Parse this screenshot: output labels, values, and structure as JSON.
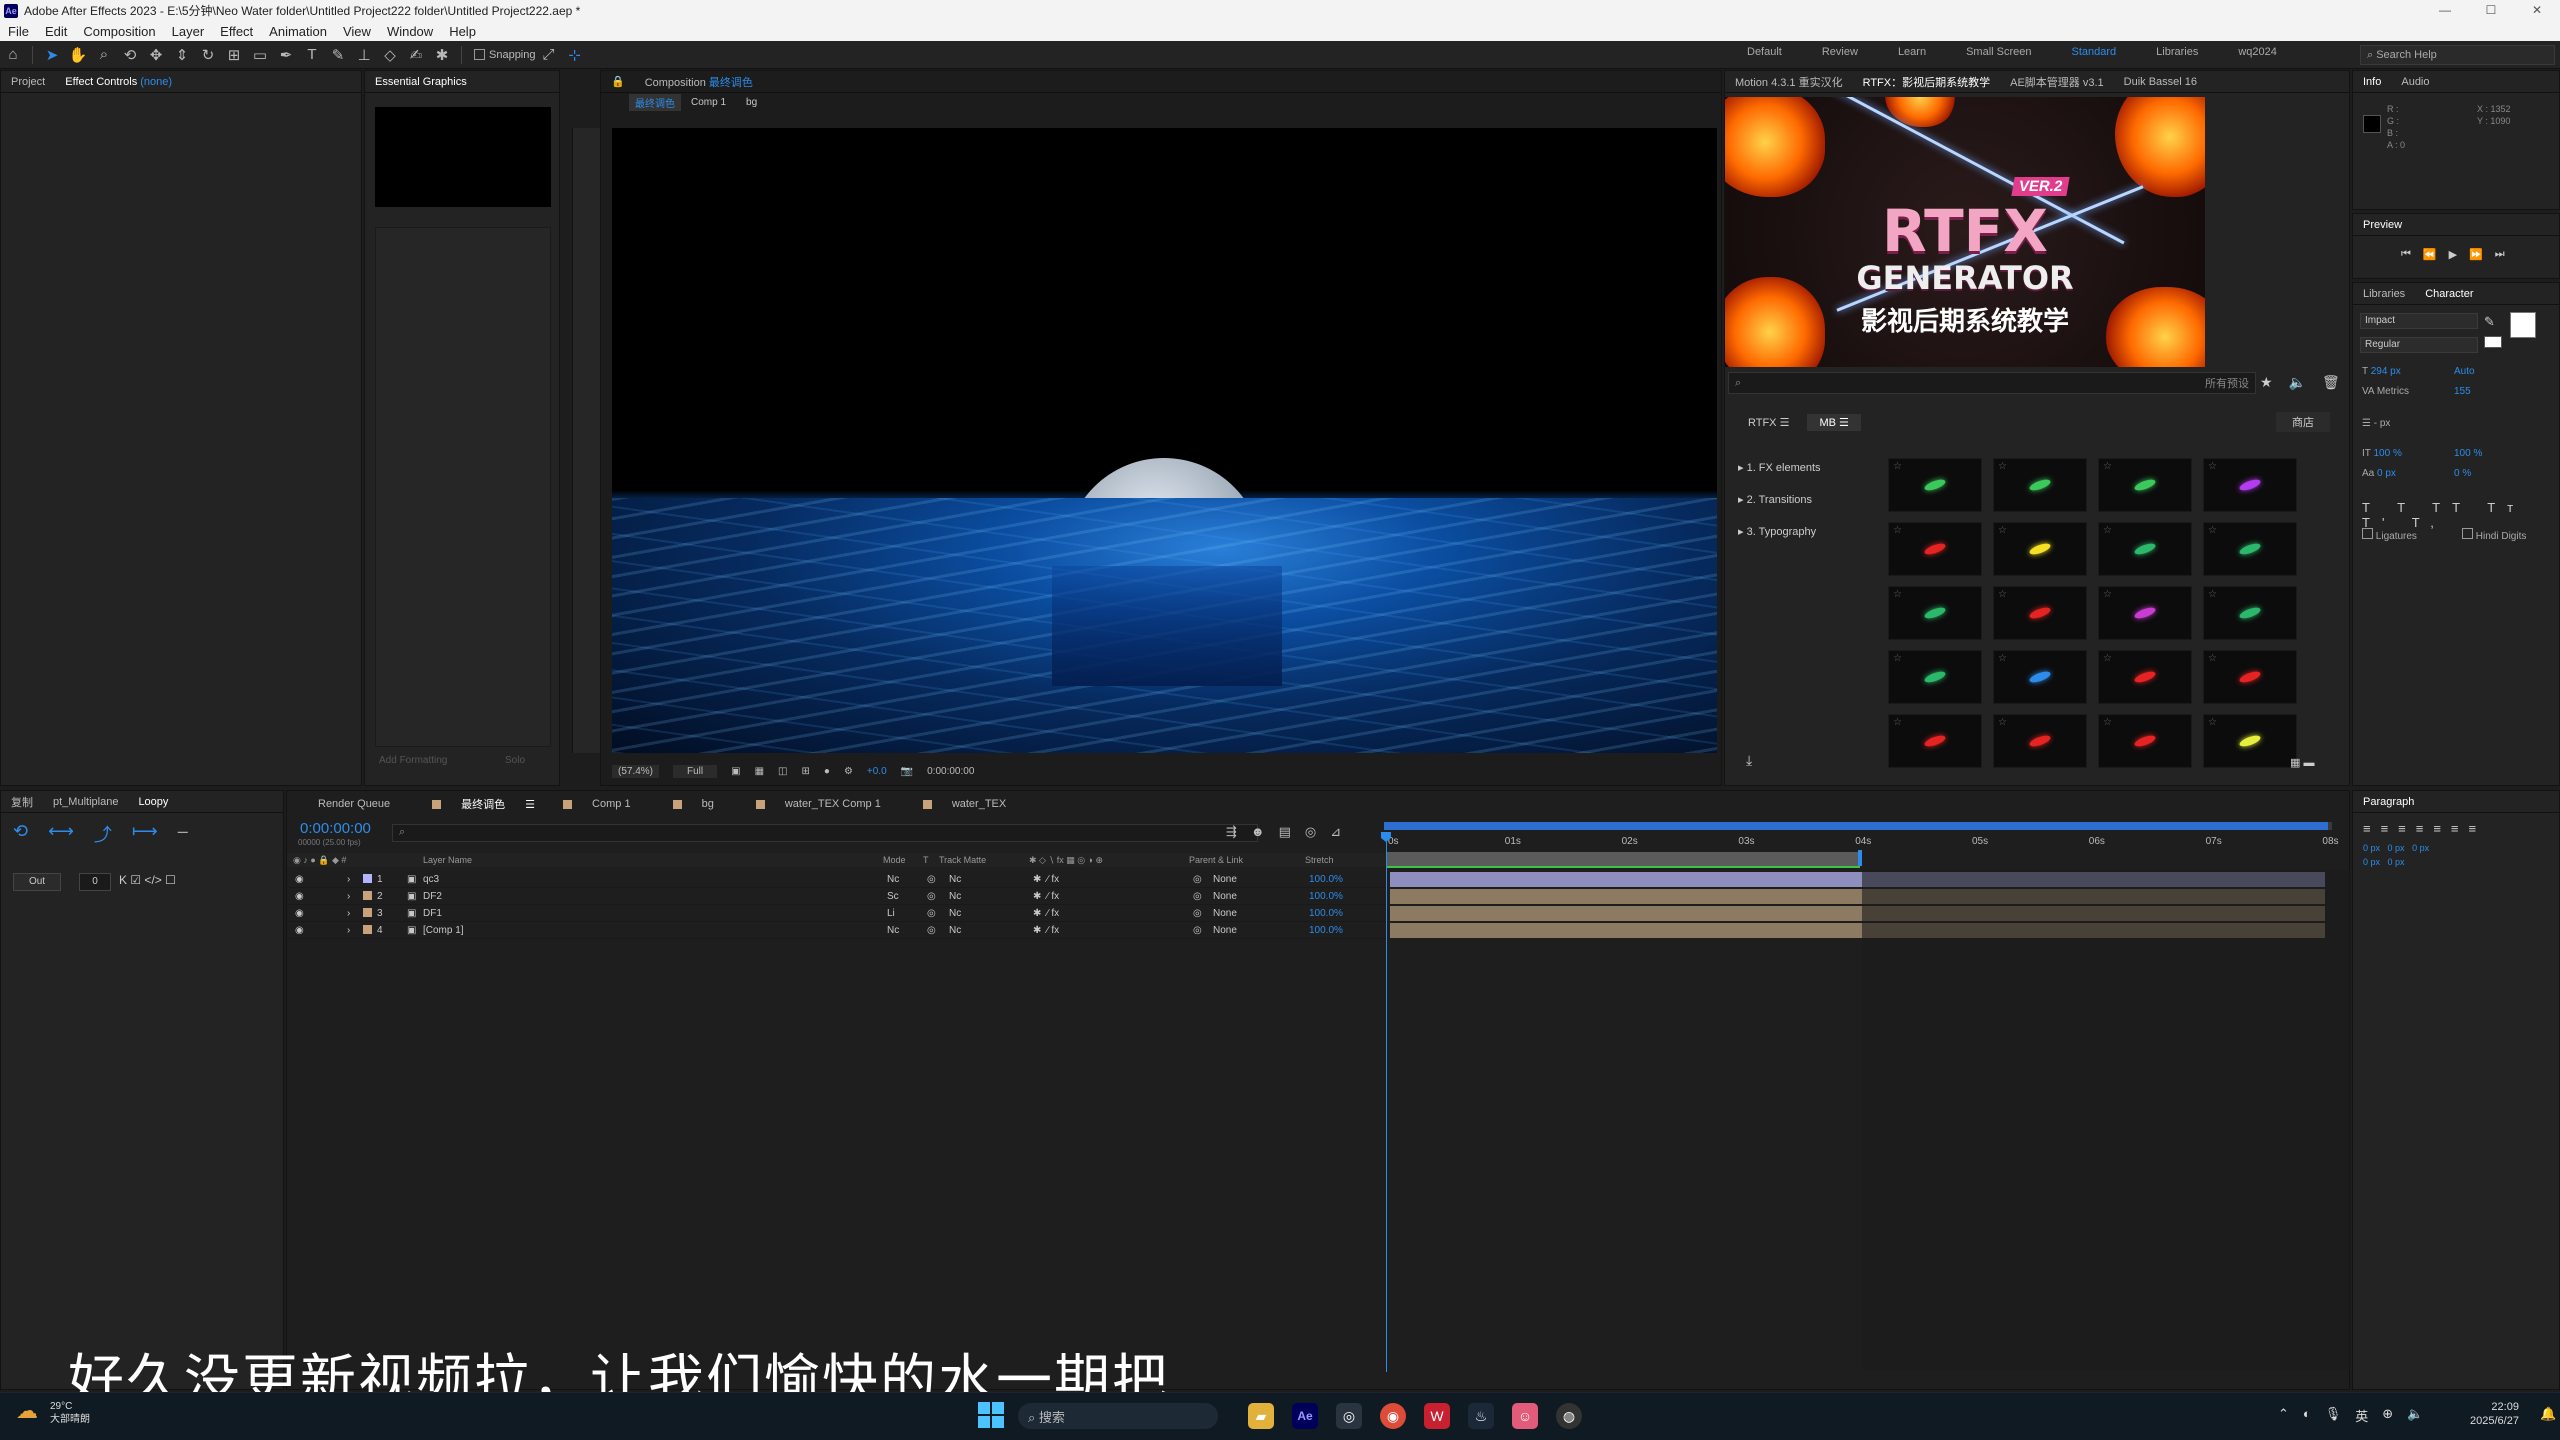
{
  "window": {
    "title": "Adobe After Effects 2023 - E:\\5分钟\\Neo Water folder\\Untitled Project222 folder\\Untitled Project222.aep *"
  },
  "menu": [
    "File",
    "Edit",
    "Composition",
    "Layer",
    "Effect",
    "Animation",
    "View",
    "Window",
    "Help"
  ],
  "toolbar": {
    "snapping": "Snapping"
  },
  "workspaces": [
    "Default",
    "Review",
    "Learn",
    "Small Screen",
    "Standard",
    "Libraries",
    "wq2024"
  ],
  "search_help": "Search Help",
  "left_panel": {
    "tab_project": "Project",
    "tab_effect_controls": "Effect Controls",
    "effect_target": "(none)"
  },
  "essential_graphics": {
    "title": "Essential Graphics",
    "add_formatting": "Add Formatting",
    "solo": "Solo"
  },
  "composition": {
    "tab": "Composition",
    "name": "最终调色",
    "breadcrumb": [
      "最终调色",
      "Comp 1",
      "bg"
    ],
    "zoom": "(57.4%)",
    "resolution": "Full",
    "time": "0:00:00:00",
    "exposure": "+0.0"
  },
  "right_tabs": [
    "Motion 4.3.1 重实汉化",
    "RTFX：影视后期系统教学",
    "AE脚本管理器 v3.1",
    "Duik Bassel 16"
  ],
  "rtfx": {
    "badge": "VER.2",
    "title": "RTFX",
    "subtitle": "GENERATOR",
    "chinese": "影视后期系统教学",
    "search_placeholder": "所有预设",
    "menu_rtfx": "RTFX",
    "menu_mb": "MB",
    "store": "商店",
    "categories": [
      "1. FX elements",
      "2. Transitions",
      "3. Typography"
    ],
    "thumb_colors": [
      "#3ac95a",
      "#3ac95a",
      "#3ac95a",
      "#b43cf0",
      "#e62323",
      "#f5e023",
      "#2bb86a",
      "#2bb86a",
      "#2bb86a",
      "#e62323",
      "#c83cd2",
      "#2bb86a",
      "#2bb86a",
      "#2d8ceb",
      "#e62323",
      "#e62323",
      "#e62323",
      "#e62323",
      "#e62323",
      "#e6f03c"
    ]
  },
  "info": {
    "tab_info": "Info",
    "tab_audio": "Audio",
    "x": "X : 1352",
    "y": "Y : 1090",
    "r": "R :",
    "g": "G :",
    "b": "B :",
    "a": "A : 0"
  },
  "preview": {
    "title": "Preview"
  },
  "character": {
    "tab_libraries": "Libraries",
    "tab_character": "Character",
    "font": "Impact",
    "style": "Regular",
    "size": "294 px",
    "leading": "Auto",
    "kerning": "Metrics",
    "tracking": "155",
    "stroke": "- px",
    "vscale": "100 %",
    "hscale": "100 %",
    "baseline": "0 px",
    "tsume": "0 %",
    "ligatures": "Ligatures",
    "hindi": "Hindi Digits"
  },
  "paragraph": {
    "title": "Paragraph",
    "values": [
      "0 px",
      "0 px",
      "0 px",
      "0 px",
      "0 px"
    ]
  },
  "loopy": {
    "tab1": "复制",
    "tab2": "pt_Multiplane",
    "tab3": "Loopy",
    "out": "Out",
    "value": "0"
  },
  "timeline": {
    "tabs": [
      "Render Queue",
      "最终调色",
      "Comp 1",
      "bg",
      "water_TEX Comp 1",
      "water_TEX"
    ],
    "tab_colors": [
      "#000000",
      "#c8a27a",
      "#c8a27a",
      "#c8a27a",
      "#c8a27a",
      "#c8a27a"
    ],
    "timecode": "0:00:00:00",
    "fps": "00000 (25.00 fps)",
    "headers": {
      "layer_name": "Layer Name",
      "mode": "Mode",
      "t": "T",
      "track_matte": "Track Matte",
      "parent": "Parent & Link",
      "stretch": "Stretch"
    },
    "ruler": [
      "0s",
      "01s",
      "02s",
      "03s",
      "04s",
      "05s",
      "06s",
      "07s",
      "08s"
    ],
    "layers": [
      {
        "num": "1",
        "name": "qc3",
        "mode": "Nc",
        "matte": "Nc",
        "parent": "None",
        "stretch": "100.0%",
        "color": "#b3b3ff"
      },
      {
        "num": "2",
        "name": "DF2",
        "mode": "Sc",
        "matte": "Nc",
        "parent": "None",
        "stretch": "100.0%",
        "color": "#c8a27a"
      },
      {
        "num": "3",
        "name": "DF1",
        "mode": "Li",
        "matte": "Nc",
        "parent": "None",
        "stretch": "100.0%",
        "color": "#c8a27a"
      },
      {
        "num": "4",
        "name": "[Comp 1]",
        "mode": "Nc",
        "matte": "Nc",
        "parent": "None",
        "stretch": "100.0%",
        "color": "#c8a27a"
      }
    ]
  },
  "subtitle": "好久没更新视频拉，让我们愉快的水一期把",
  "taskbar": {
    "weather_temp": "29°C",
    "weather_desc": "大部晴朗",
    "search": "搜索",
    "time": "22:09",
    "date": "2025/6/27",
    "ime": "英"
  }
}
